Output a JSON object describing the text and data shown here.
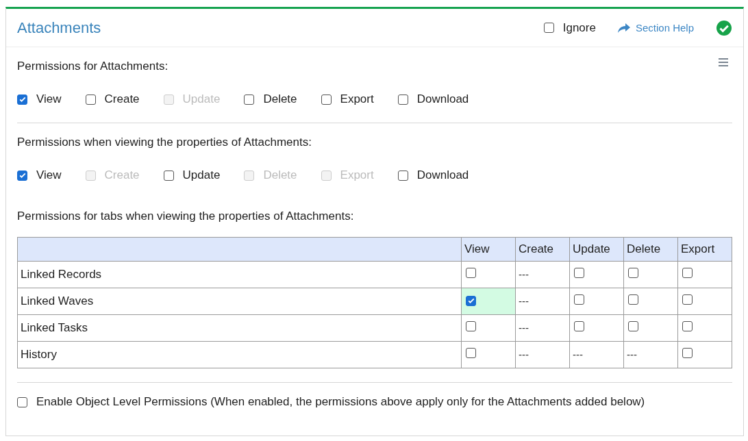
{
  "section": {
    "title": "Attachments",
    "ignore": {
      "label": "Ignore",
      "checked": false
    },
    "help_link": "Section Help",
    "complete": true
  },
  "groups": [
    {
      "heading": "Permissions for Attachments:",
      "options": [
        {
          "label": "View",
          "checked": true,
          "disabled": false
        },
        {
          "label": "Create",
          "checked": false,
          "disabled": false
        },
        {
          "label": "Update",
          "checked": false,
          "disabled": true
        },
        {
          "label": "Delete",
          "checked": false,
          "disabled": false
        },
        {
          "label": "Export",
          "checked": false,
          "disabled": false
        },
        {
          "label": "Download",
          "checked": false,
          "disabled": false
        }
      ]
    },
    {
      "heading": "Permissions when viewing the properties of Attachments:",
      "options": [
        {
          "label": "View",
          "checked": true,
          "disabled": false
        },
        {
          "label": "Create",
          "checked": false,
          "disabled": true
        },
        {
          "label": "Update",
          "checked": false,
          "disabled": false
        },
        {
          "label": "Delete",
          "checked": false,
          "disabled": true
        },
        {
          "label": "Export",
          "checked": false,
          "disabled": true
        },
        {
          "label": "Download",
          "checked": false,
          "disabled": false
        }
      ]
    }
  ],
  "tabs_heading": "Permissions for tabs when viewing the properties of Attachments:",
  "table": {
    "columns": [
      "View",
      "Create",
      "Update",
      "Delete",
      "Export"
    ],
    "rows": [
      {
        "label": "Linked Records",
        "cells": [
          {
            "kind": "checkbox",
            "checked": false,
            "highlighted": false
          },
          {
            "kind": "text",
            "text": "---"
          },
          {
            "kind": "checkbox",
            "checked": false,
            "highlighted": false
          },
          {
            "kind": "checkbox",
            "checked": false,
            "highlighted": false
          },
          {
            "kind": "checkbox",
            "checked": false,
            "highlighted": false
          }
        ]
      },
      {
        "label": "Linked Waves",
        "cells": [
          {
            "kind": "checkbox",
            "checked": true,
            "highlighted": true
          },
          {
            "kind": "text",
            "text": "---"
          },
          {
            "kind": "checkbox",
            "checked": false,
            "highlighted": false
          },
          {
            "kind": "checkbox",
            "checked": false,
            "highlighted": false
          },
          {
            "kind": "checkbox",
            "checked": false,
            "highlighted": false
          }
        ]
      },
      {
        "label": "Linked Tasks",
        "cells": [
          {
            "kind": "checkbox",
            "checked": false,
            "highlighted": false
          },
          {
            "kind": "text",
            "text": "---"
          },
          {
            "kind": "checkbox",
            "checked": false,
            "highlighted": false
          },
          {
            "kind": "checkbox",
            "checked": false,
            "highlighted": false
          },
          {
            "kind": "checkbox",
            "checked": false,
            "highlighted": false
          }
        ]
      },
      {
        "label": "History",
        "cells": [
          {
            "kind": "checkbox",
            "checked": false,
            "highlighted": false
          },
          {
            "kind": "text",
            "text": "---"
          },
          {
            "kind": "text",
            "text": "---"
          },
          {
            "kind": "text",
            "text": "---"
          },
          {
            "kind": "checkbox",
            "checked": false,
            "highlighted": false
          }
        ]
      }
    ]
  },
  "object_level": {
    "label": "Enable Object Level Permissions (When enabled, the permissions above apply only for the Attachments added below)",
    "checked": false
  }
}
